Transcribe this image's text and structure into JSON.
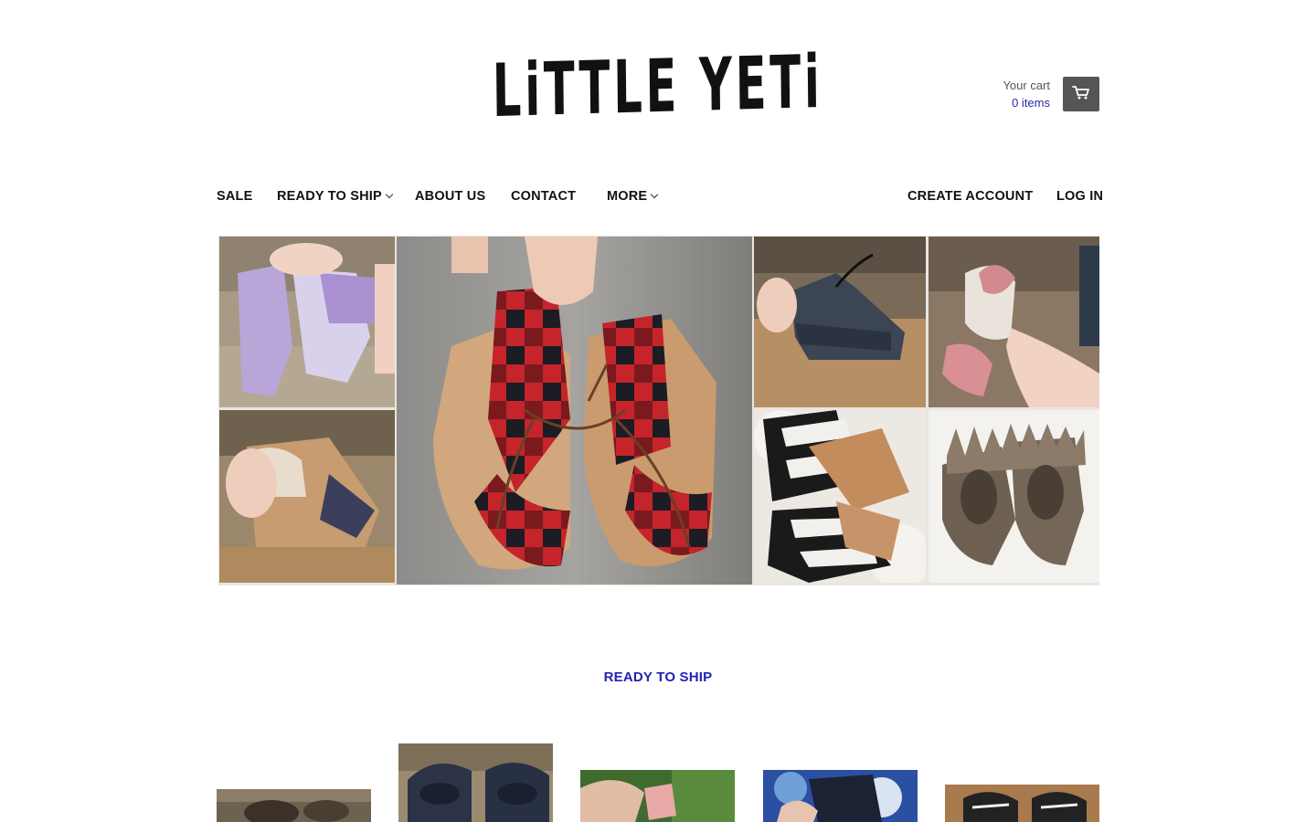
{
  "header": {
    "logo_text": "LiTTLE YETi",
    "cart": {
      "label": "Your cart",
      "count": "0 items",
      "icon": "cart-icon"
    }
  },
  "nav": {
    "left": [
      {
        "label": "SALE",
        "has_dropdown": false
      },
      {
        "label": "READY TO SHIP",
        "has_dropdown": true
      },
      {
        "label": "ABOUT US",
        "has_dropdown": false
      },
      {
        "label": "CONTACT",
        "has_dropdown": false
      },
      {
        "label": "MORE",
        "has_dropdown": true
      }
    ],
    "right": [
      {
        "label": "CREATE ACCOUNT"
      },
      {
        "label": "LOG IN"
      }
    ]
  },
  "hero": {
    "description_tiles": [
      "purple-fringe-moccasins",
      "tan-lace-up-bootie",
      "buffalo-plaid-lace-up-booties",
      "navy-fringe-bootie",
      "pink-bow-moccasins",
      "striped-tan-moccasins",
      "brown-fringe-moccasins"
    ]
  },
  "featured": {
    "title": "READY TO SHIP",
    "products": [
      {
        "name": "product-1"
      },
      {
        "name": "product-2"
      },
      {
        "name": "product-3"
      },
      {
        "name": "product-4"
      },
      {
        "name": "product-5"
      }
    ]
  },
  "colors": {
    "accent_link": "#2323b5",
    "cart_button": "#555555",
    "text": "#111111"
  }
}
